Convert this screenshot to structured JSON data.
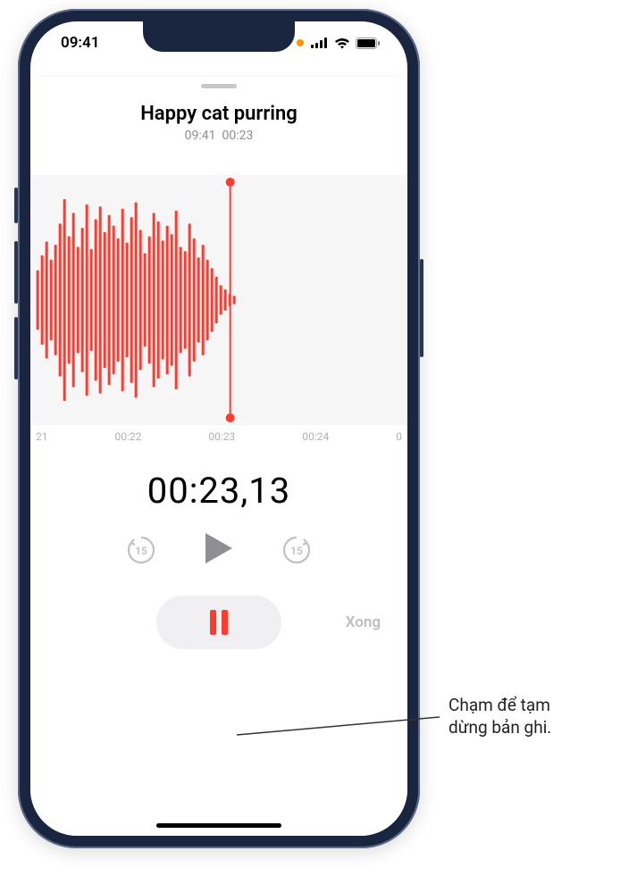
{
  "status": {
    "time": "09:41",
    "orangeDot": true
  },
  "recording": {
    "title": "Happy cat purring",
    "subTime": "09:41",
    "subDuration": "00:23"
  },
  "waveform": {
    "samples": [
      0.28,
      0.42,
      0.55,
      0.38,
      0.52,
      0.72,
      0.95,
      0.6,
      0.82,
      0.5,
      0.68,
      0.9,
      0.48,
      0.76,
      0.88,
      0.64,
      0.8,
      0.7,
      0.58,
      0.86,
      0.54,
      0.78,
      0.92,
      0.66,
      0.44,
      0.6,
      0.82,
      0.74,
      0.56,
      0.7,
      0.62,
      0.84,
      0.5,
      0.46,
      0.72,
      0.58,
      0.4,
      0.52,
      0.38,
      0.3,
      0.22,
      0.14,
      0.1,
      0.06,
      0.04
    ],
    "playheadRatio": 0.53,
    "ticks": [
      "21",
      "00:22",
      "00:23",
      "00:24",
      "0"
    ]
  },
  "timer": "00:23,13",
  "controls": {
    "skipBack": "15",
    "skipForward": "15",
    "doneLabel": "Xong"
  },
  "callout": {
    "line1": "Chạm để tạm",
    "line2": "dừng bản ghi."
  },
  "colors": {
    "red": "#ff3b30",
    "grayText": "#8e8e93"
  }
}
